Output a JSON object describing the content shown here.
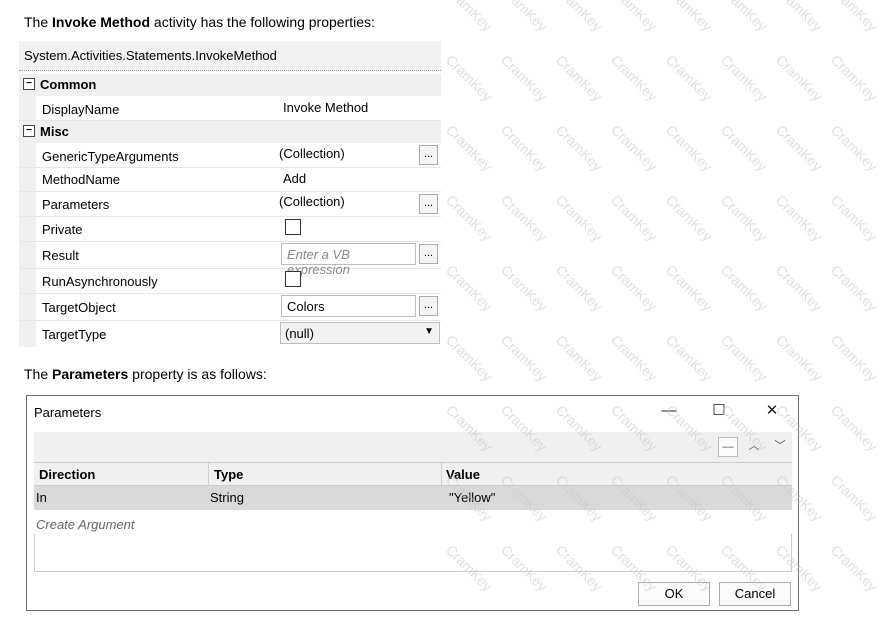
{
  "intro1": {
    "pre": "The ",
    "bold": "Invoke Method",
    "post": " activity has the following properties:"
  },
  "intro2": {
    "pre": "The ",
    "bold": "Parameters",
    "post": " property is as follows:"
  },
  "grid": {
    "header": "System.Activities.Statements.InvokeMethod",
    "cat_common": "Common",
    "cat_misc": "Misc",
    "collapse_glyph": "⊟",
    "ellipsis": "...",
    "props": {
      "display_name": {
        "name": "DisplayName",
        "value": "Invoke Method"
      },
      "generic": {
        "name": "GenericTypeArguments",
        "value": "(Collection)"
      },
      "method": {
        "name": "MethodName",
        "value": "Add"
      },
      "parameters": {
        "name": "Parameters",
        "value": "(Collection)"
      },
      "private": {
        "name": "Private",
        "checked": false
      },
      "result": {
        "name": "Result",
        "placeholder": "Enter a VB expression"
      },
      "async": {
        "name": "RunAsynchronously",
        "checked": false
      },
      "target_object": {
        "name": "TargetObject",
        "value": "Colors"
      },
      "target_type": {
        "name": "TargetType",
        "value": "(null)"
      }
    }
  },
  "dialog": {
    "title": "Parameters",
    "minimize": "—",
    "maximize": "☐",
    "close": "✕",
    "tb_remove": "—",
    "tb_up": "︿",
    "tb_down": "﹀",
    "columns": [
      "Direction",
      "Type",
      "Value"
    ],
    "rows": [
      {
        "direction": "In",
        "type": "String",
        "value": "\"Yellow\""
      }
    ],
    "create_argument": "Create Argument",
    "ok": "OK",
    "cancel": "Cancel"
  },
  "watermark": "CramKey"
}
